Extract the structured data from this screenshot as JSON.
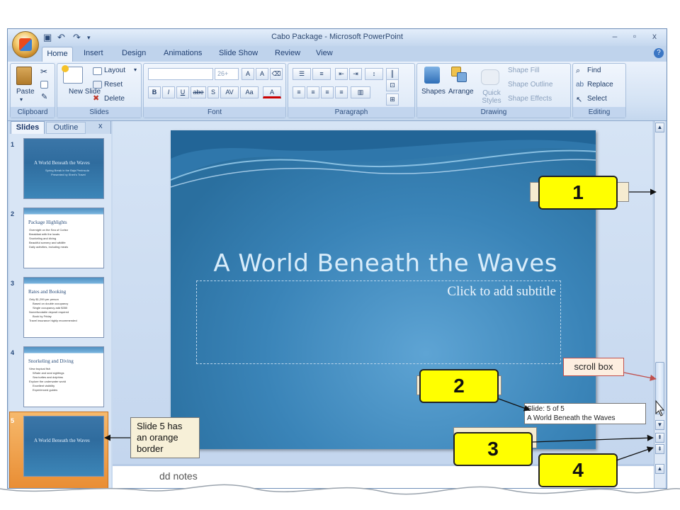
{
  "window": {
    "title": "Cabo Package - Microsoft PowerPoint",
    "controls": [
      "–",
      "▫",
      "x"
    ]
  },
  "ribbon": {
    "tabs": [
      "Home",
      "Insert",
      "Design",
      "Animations",
      "Slide Show",
      "Review",
      "View"
    ],
    "clipboard": {
      "paste": "Paste",
      "label": "Clipboard"
    },
    "slides": {
      "new_slide": "New Slide",
      "layout": "Layout",
      "reset": "Reset",
      "delete": "Delete",
      "label": "Slides"
    },
    "font": {
      "size": "26+",
      "label": "Font",
      "buttons": [
        "B",
        "I",
        "U",
        "abe",
        "S",
        "AV",
        "Aa",
        "A"
      ]
    },
    "paragraph": {
      "label": "Paragraph"
    },
    "drawing": {
      "shapes": "Shapes",
      "arrange": "Arrange",
      "quick_styles": "Quick Styles",
      "shape_fill": "Shape Fill",
      "shape_outline": "Shape Outline",
      "shape_effects": "Shape Effects",
      "label": "Drawing"
    },
    "editing": {
      "find": "Find",
      "replace": "Replace",
      "select": "Select",
      "label": "Editing"
    }
  },
  "pane": {
    "tab_slides": "Slides",
    "tab_outline": "Outline",
    "close": "x"
  },
  "thumbnails": [
    {
      "num": "1",
      "title": "A World Beneath the Waves",
      "lines": [
        "Spring Break in the Baja Peninsula",
        "Presented by Sheri's Travel"
      ]
    },
    {
      "num": "2",
      "title": "Package Highlights",
      "lines": [
        "Overnight on the Sea of Cortez",
        "Breakfast with the locals",
        "Snorkeling and diving",
        "Beautiful scenery and wildlife",
        "Daily activities, including meals"
      ]
    },
    {
      "num": "3",
      "title": "Rates and Booking",
      "lines": [
        "Only $1,299 per person",
        "Based on double occupancy",
        "Single occupancy add $350",
        "Nonrefundable deposit required",
        "Book by Friday",
        "Travel insurance highly recommended"
      ]
    },
    {
      "num": "4",
      "title": "Snorkeling and Diving",
      "lines": [
        "View tropical fish",
        "Whale and seal sightings",
        "Sea turtles and dolphins",
        "Explore the underwater world",
        "Excellent visibility",
        "Experienced guides"
      ]
    },
    {
      "num": "5",
      "title": "A World Beneath the Waves",
      "lines": []
    }
  ],
  "slide": {
    "title": "A World Beneath the Waves",
    "subtitle_placeholder": "Click to add subtitle"
  },
  "notes": {
    "placeholder": "Click to add notes",
    "visible_text": "dd notes"
  },
  "tooltip": {
    "line1": "Slide: 5 of 5",
    "line2": "A World Beneath the Waves"
  },
  "callouts": {
    "c1": "1",
    "c2": "2",
    "c3": "3",
    "c4": "4",
    "scroll_box": "scroll box",
    "slide5_note": "Slide 5 has an orange border"
  },
  "colors": {
    "callout_fill": "#ffff00",
    "accent_orange": "#e98d33",
    "scroll_note_border": "#c0504d"
  }
}
